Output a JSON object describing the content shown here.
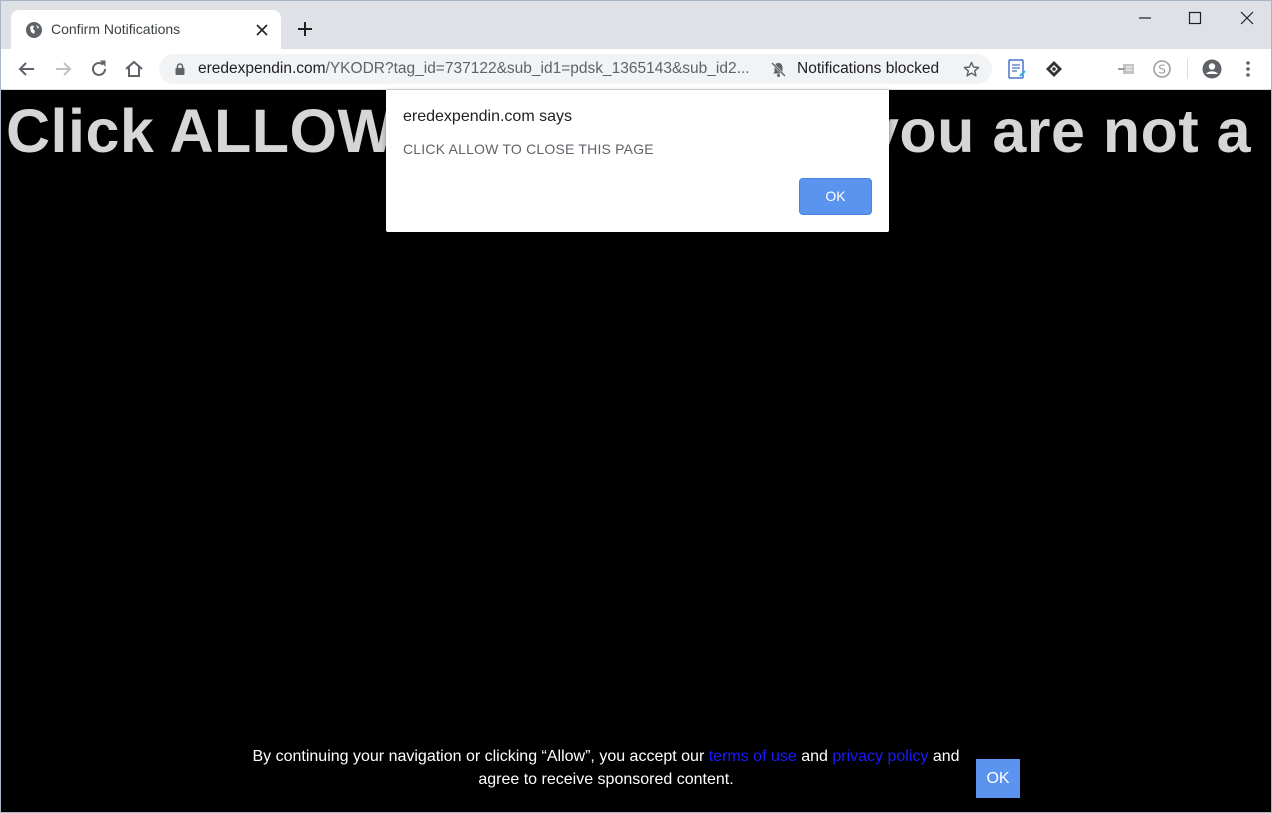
{
  "browser": {
    "tab": {
      "title": "Confirm Notifications",
      "favicon": "globe-icon"
    },
    "url": {
      "host": "eredexpendin.com",
      "path": "/YKODR?tag_id=737122&sub_id1=pdsk_1365143&sub_id2..."
    },
    "notifications_status": "Notifications blocked",
    "icons": [
      "back-icon",
      "forward-icon",
      "reload-icon",
      "home-icon",
      "lock-icon",
      "bell-off-icon",
      "star-icon",
      "extension-notes-icon",
      "extension-diamond-icon",
      "extension-grey-icon",
      "extension-s-icon",
      "profile-icon",
      "menu-icon"
    ]
  },
  "page": {
    "headline": "Click ALLOW to confirm that you are not a"
  },
  "dialog": {
    "title": "eredexpendin.com says",
    "message": "CLICK ALLOW TO CLOSE THIS PAGE",
    "ok_label": "OK"
  },
  "consent": {
    "text_before": "By continuing your navigation or clicking “Allow”, you accept our ",
    "terms_link": "terms of use",
    "text_and": " and ",
    "privacy_link": "privacy policy",
    "text_after": " and agree to receive sponsored content.",
    "ok_label": "OK"
  },
  "colors": {
    "accent": "#5b94ef",
    "headline": "#d6d6d6",
    "link": "#1a1aff"
  }
}
